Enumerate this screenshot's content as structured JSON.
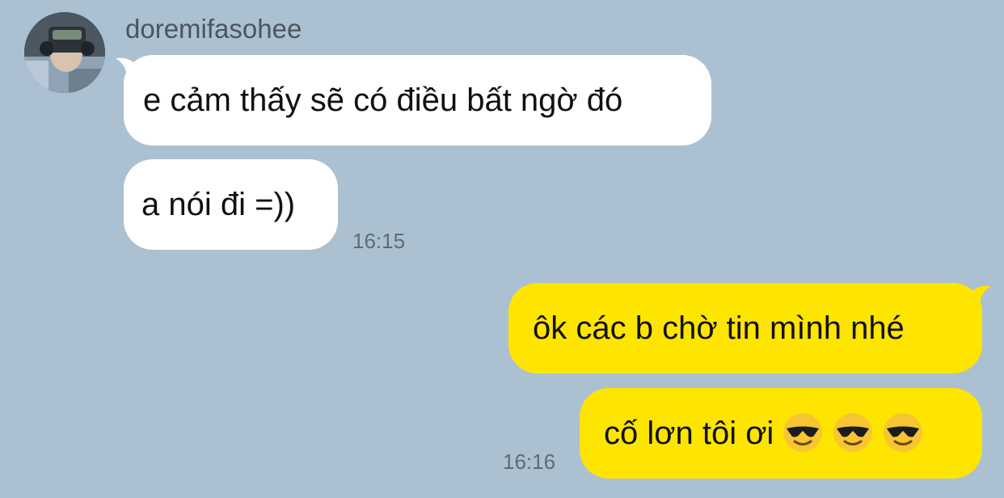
{
  "chat": {
    "incoming": {
      "sender_name": "doremifasohee",
      "avatar": "profile-photo",
      "messages": [
        {
          "text": "e cảm thấy sẽ có điều bất ngờ đó"
        },
        {
          "text": "a nói đi =))"
        }
      ],
      "time": "16:15"
    },
    "outgoing": {
      "messages": [
        {
          "text": "ôk các b chờ tin mình nhé"
        },
        {
          "text": "cố lơn tôi ơi",
          "emojis": [
            "smiling-face-with-sunglasses",
            "smiling-face-with-sunglasses",
            "smiling-face-with-sunglasses"
          ]
        }
      ],
      "time": "16:16"
    }
  },
  "colors": {
    "background": "#abc1d1",
    "incoming_bubble": "#ffffff",
    "outgoing_bubble": "#fde500",
    "timestamp": "#5e6b75",
    "sender_name": "#4a5560"
  }
}
